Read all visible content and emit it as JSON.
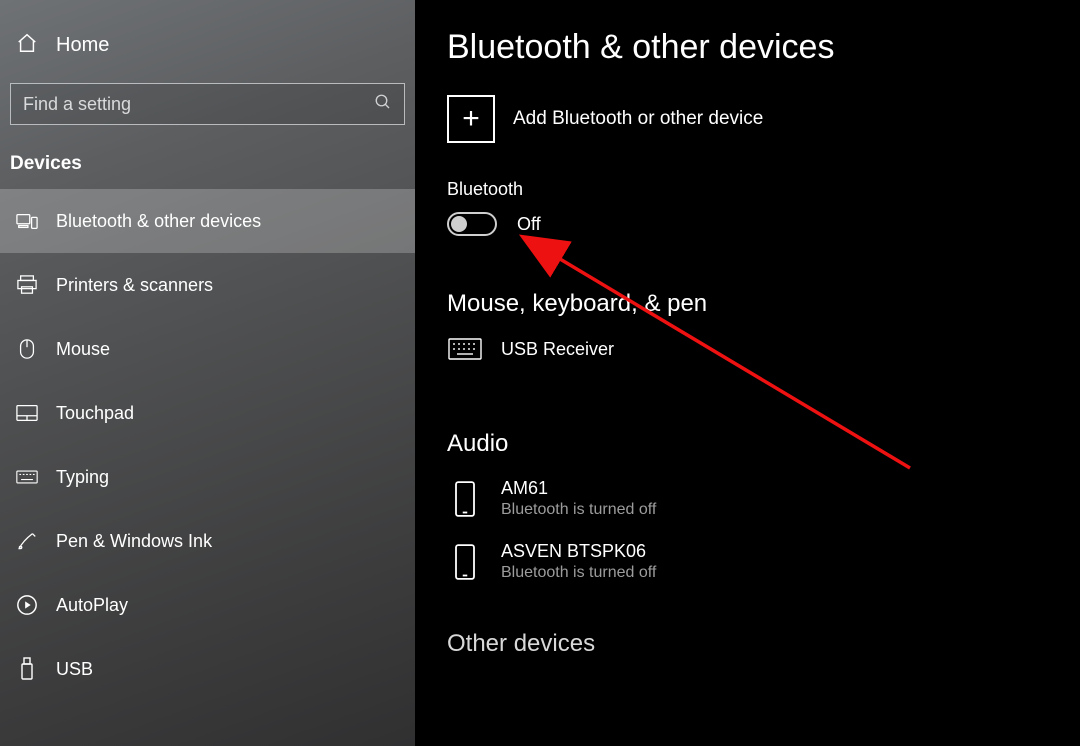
{
  "sidebar": {
    "home_label": "Home",
    "search_placeholder": "Find a setting",
    "section_title": "Devices",
    "items": [
      {
        "label": "Bluetooth & other devices"
      },
      {
        "label": "Printers & scanners"
      },
      {
        "label": "Mouse"
      },
      {
        "label": "Touchpad"
      },
      {
        "label": "Typing"
      },
      {
        "label": "Pen & Windows Ink"
      },
      {
        "label": "AutoPlay"
      },
      {
        "label": "USB"
      }
    ]
  },
  "main": {
    "title": "Bluetooth & other devices",
    "add_label": "Add Bluetooth or other device",
    "bluetooth_label": "Bluetooth",
    "toggle_state": "Off",
    "group_mouse": "Mouse, keyboard, & pen",
    "device_usb_receiver": "USB Receiver",
    "group_audio": "Audio",
    "audio_devices": [
      {
        "name": "AM61",
        "status": "Bluetooth is turned off"
      },
      {
        "name": "ASVEN BTSPK06",
        "status": "Bluetooth is turned off"
      }
    ],
    "group_other": "Other devices"
  }
}
